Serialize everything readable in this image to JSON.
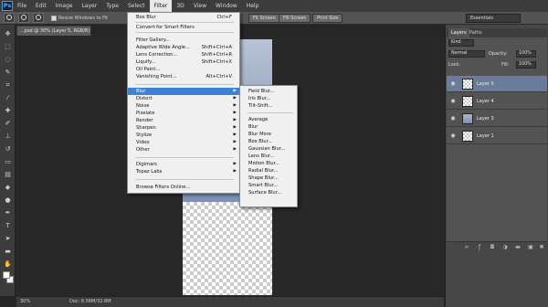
{
  "menubar": {
    "logo": "Ps",
    "items": [
      "File",
      "Edit",
      "Image",
      "Layer",
      "Type",
      "Select",
      "Filter",
      "3D",
      "View",
      "Window",
      "Help"
    ],
    "active_index": 6
  },
  "options_bar": {
    "checkbox_label": "Resize Windows to Fit",
    "buttons": [
      "Fit Screen",
      "Fill Screen",
      "Print Size"
    ],
    "workspace": "Essentials"
  },
  "document": {
    "tab_title": "...psd @ 30% (Layer 5, RGB/8) *",
    "zoom": "30%",
    "doc_info": "Doc: 8.58M/32.8M"
  },
  "filter_menu": {
    "items": [
      {
        "label": "Box Blur",
        "shortcut": "Ctrl+F"
      },
      {
        "label": "Convert for Smart Filters",
        "shortcut": ""
      },
      {
        "label": "Filter Gallery...",
        "shortcut": ""
      },
      {
        "label": "Adaptive Wide Angle...",
        "shortcut": "Shift+Ctrl+A"
      },
      {
        "label": "Lens Correction...",
        "shortcut": "Shift+Ctrl+R"
      },
      {
        "label": "Liquify...",
        "shortcut": "Shift+Ctrl+X"
      },
      {
        "label": "Oil Paint...",
        "shortcut": ""
      },
      {
        "label": "Vanishing Point...",
        "shortcut": "Alt+Ctrl+V"
      },
      {
        "label": "Blur",
        "shortcut": ""
      },
      {
        "label": "Distort",
        "shortcut": ""
      },
      {
        "label": "Noise",
        "shortcut": ""
      },
      {
        "label": "Pixelate",
        "shortcut": ""
      },
      {
        "label": "Render",
        "shortcut": ""
      },
      {
        "label": "Sharpen",
        "shortcut": ""
      },
      {
        "label": "Stylize",
        "shortcut": ""
      },
      {
        "label": "Video",
        "shortcut": ""
      },
      {
        "label": "Other",
        "shortcut": ""
      },
      {
        "label": "Digimarc",
        "shortcut": ""
      },
      {
        "label": "Topaz Labs",
        "shortcut": ""
      },
      {
        "label": "Browse Filters Online...",
        "shortcut": ""
      }
    ]
  },
  "blur_submenu": {
    "items": [
      "Field Blur...",
      "Iris Blur...",
      "Tilt-Shift...",
      "Average",
      "Blur",
      "Blur More",
      "Box Blur...",
      "Gaussian Blur...",
      "Lens Blur...",
      "Motion Blur...",
      "Radial Blur...",
      "Shape Blur...",
      "Smart Blur...",
      "Surface Blur..."
    ]
  },
  "layers_panel": {
    "tabs": [
      "Layers",
      "Paths"
    ],
    "filter_kind": "Kind",
    "blend_mode": "Normal",
    "opacity_label": "Opacity:",
    "opacity": "100%",
    "lock_label": "Lock:",
    "fill_label": "Fill:",
    "fill": "100%",
    "layers": [
      {
        "name": "Layer 5",
        "selected": true
      },
      {
        "name": "Layer 4",
        "selected": false
      },
      {
        "name": "Layer 3",
        "selected": false
      },
      {
        "name": "Layer 1",
        "selected": false
      }
    ]
  },
  "colors": {
    "menu_highlight": "#3e82d6",
    "selected_layer": "#6a7c99",
    "ui_dark": "#262626"
  }
}
